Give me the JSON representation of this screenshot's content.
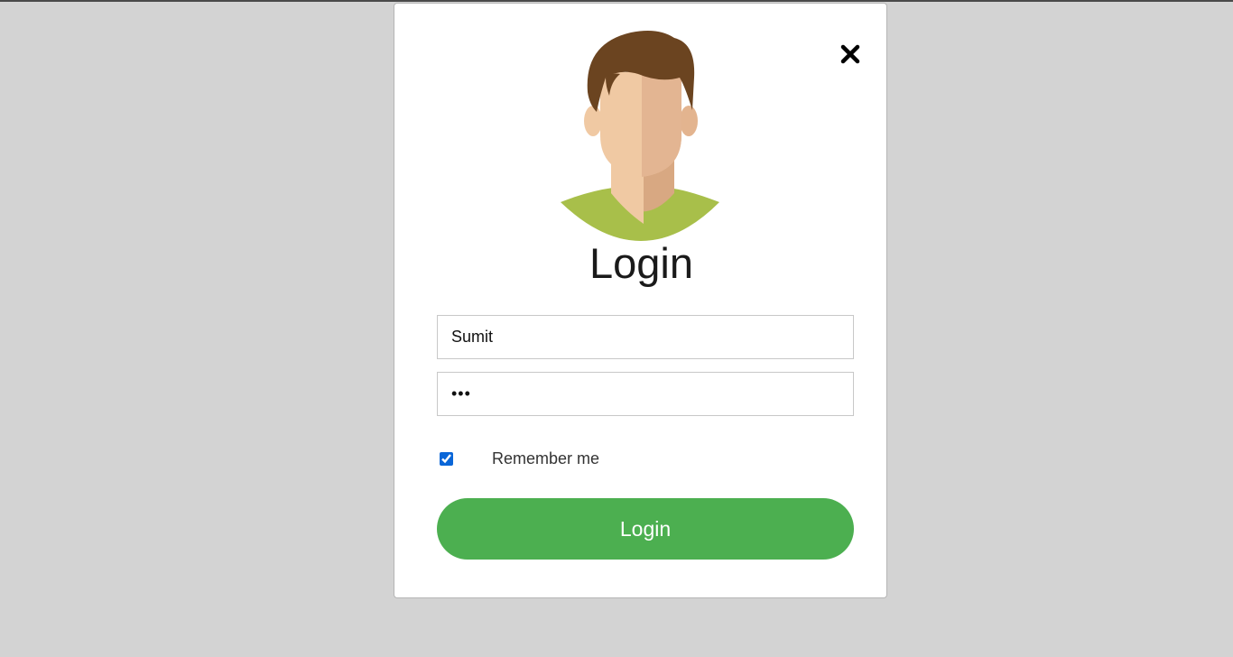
{
  "modal": {
    "title": "Login",
    "close_icon": "close-icon",
    "avatar_icon": "user-avatar",
    "username": {
      "value": "Sumit",
      "placeholder": ""
    },
    "password": {
      "value": "•••",
      "placeholder": ""
    },
    "remember": {
      "label": "Remember me",
      "checked": true
    },
    "submit_label": "Login"
  },
  "colors": {
    "background": "#d3d3d3",
    "button": "#4caf50",
    "shirt": "#a8bf4a",
    "hair": "#6b4420",
    "skin": "#f0c9a3"
  }
}
